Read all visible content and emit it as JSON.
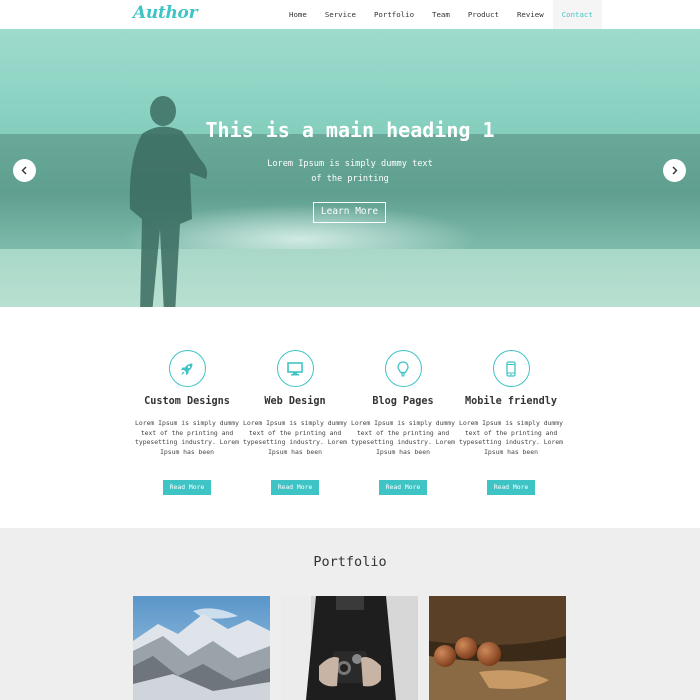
{
  "nav": {
    "logo": "Author",
    "items": [
      {
        "label": "Home"
      },
      {
        "label": "Service"
      },
      {
        "label": "Portfolio"
      },
      {
        "label": "Team"
      },
      {
        "label": "Product"
      },
      {
        "label": "Review"
      },
      {
        "label": "Contact"
      }
    ],
    "active": "Contact"
  },
  "hero": {
    "title": "This is a main heading 1",
    "subtitle_line1": "Lorem Ipsum is simply dummy text",
    "subtitle_line2": "of the printing",
    "button": "Learn More",
    "prev_icon": "chevron-left-icon",
    "next_icon": "chevron-right-icon"
  },
  "services": [
    {
      "icon": "rocket-icon",
      "title": "Custom Designs",
      "text": "Lorem Ipsum is simply dummy text of the printing and typesetting industry. Lorem Ipsum has been",
      "button": "Read More"
    },
    {
      "icon": "monitor-icon",
      "title": "Web Design",
      "text": "Lorem Ipsum is simply dummy text of the printing and typesetting industry. Lorem Ipsum has been",
      "button": "Read More"
    },
    {
      "icon": "lightbulb-icon",
      "title": "Blog Pages",
      "text": "Lorem Ipsum is simply dummy text of the printing and typesetting industry. Lorem Ipsum has been",
      "button": "Read More"
    },
    {
      "icon": "mobile-icon",
      "title": "Mobile friendly",
      "text": "Lorem Ipsum is simply dummy text of the printing and typesetting industry. Lorem Ipsum has been",
      "button": "Read More"
    }
  ],
  "portfolio": {
    "title": "Portfolio",
    "images": [
      "mountains",
      "camera",
      "wooden-balls"
    ]
  },
  "colors": {
    "accent": "#3fc4c6",
    "portfolio_bg": "#eeeeee"
  }
}
